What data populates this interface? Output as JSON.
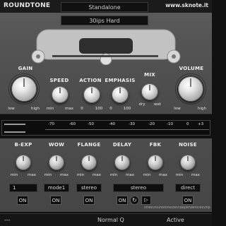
{
  "header": {
    "brand": "ROUNDTONE",
    "mode": "Standalone",
    "site": "www.sknote.it"
  },
  "preset": {
    "name": "30ips Hard"
  },
  "top_controls": {
    "gain": {
      "label": "GAIN",
      "min": "low",
      "max": "high"
    },
    "speed": {
      "label": "SPEED",
      "min": "min",
      "max": "max"
    },
    "action": {
      "label": "ACTION",
      "min": "0",
      "max": "100"
    },
    "emphasis": {
      "label": "EMPHASIS",
      "min": "0",
      "max": "100"
    },
    "mix": {
      "label": "MIX",
      "min": "dry",
      "max": "wet"
    },
    "volume": {
      "label": "VOLUME",
      "min": "low",
      "max": "high"
    }
  },
  "meter": {
    "scale": [
      "-70",
      "-60",
      "-50",
      "-40",
      "-30",
      "-20",
      "-10",
      "0",
      "+3"
    ]
  },
  "bottom_controls": [
    {
      "label": "B-EXP",
      "min": "min",
      "max": "max",
      "field": "1",
      "button": "ON"
    },
    {
      "label": "WOW",
      "min": "min",
      "max": "max",
      "field": "mode1",
      "button": "ON"
    },
    {
      "label": "FLANGE",
      "min": "min",
      "max": "max",
      "field": "stereo",
      "button": "ON"
    },
    {
      "label": "DELAY",
      "min": "min",
      "max": "max",
      "field": "stereo",
      "button": "ON"
    },
    {
      "label": "FBK",
      "min": "min",
      "max": "max",
      "field": "",
      "button": ""
    },
    {
      "label": "NOISE",
      "min": "min",
      "max": "max",
      "field": "direct",
      "button": "ON"
    }
  ],
  "file_path": "sfiles\\roundtone\\dev\\dependencies\\mp",
  "footer": {
    "left": "---",
    "quality": "Normal Q",
    "status": "Active"
  }
}
